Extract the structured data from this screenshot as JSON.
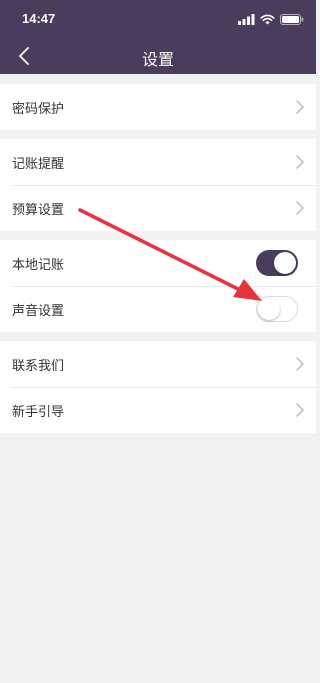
{
  "status_bar": {
    "time": "14:47",
    "signal_icon": "signal-bars-icon",
    "wifi_icon": "wifi-icon",
    "battery_icon": "battery-icon"
  },
  "nav": {
    "title": "设置",
    "back_icon": "chevron-left-icon"
  },
  "sections": [
    {
      "items": [
        {
          "label": "密码保护",
          "control": "chevron"
        }
      ]
    },
    {
      "items": [
        {
          "label": "记账提醒",
          "control": "chevron"
        },
        {
          "label": "预算设置",
          "control": "chevron"
        }
      ]
    },
    {
      "items": [
        {
          "label": "本地记账",
          "control": "toggle",
          "enabled": true
        },
        {
          "label": "声音设置",
          "control": "toggle",
          "enabled": false
        }
      ]
    },
    {
      "items": [
        {
          "label": "联系我们",
          "control": "chevron"
        },
        {
          "label": "新手引导",
          "control": "chevron"
        }
      ]
    }
  ],
  "colors": {
    "header_bg": "#4a3c5c",
    "page_bg": "#f2f2f4",
    "toggle_on": "#4a3c5c",
    "annotation_arrow": "#e8333a"
  }
}
